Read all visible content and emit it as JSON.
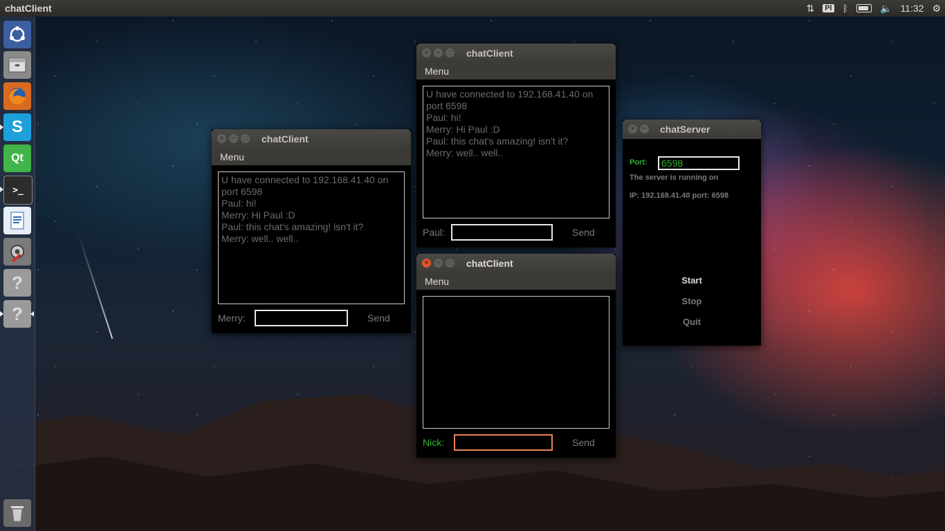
{
  "topbar": {
    "app_title": "chatClient",
    "keyboard_layout": "Pl",
    "time": "11:32"
  },
  "launcher": {
    "items": [
      {
        "name": "Dash home",
        "icon": "ubuntu-logo-icon"
      },
      {
        "name": "Files",
        "icon": "file-manager-icon"
      },
      {
        "name": "Firefox",
        "icon": "firefox-icon"
      },
      {
        "name": "Skype",
        "icon": "skype-icon",
        "glyph": "S"
      },
      {
        "name": "Qt Creator",
        "icon": "qt-creator-icon",
        "glyph": "Qt"
      },
      {
        "name": "Terminal",
        "icon": "terminal-icon",
        "glyph": ">_"
      },
      {
        "name": "LibreOffice Writer",
        "icon": "writer-icon"
      },
      {
        "name": "System Settings",
        "icon": "settings-icon"
      },
      {
        "name": "Unknown app",
        "icon": "unknown-app-icon",
        "glyph": "?"
      },
      {
        "name": "Unknown app",
        "icon": "unknown-app-icon",
        "glyph": "?"
      },
      {
        "name": "Trash",
        "icon": "trash-icon"
      }
    ]
  },
  "client_merry": {
    "title": "chatClient",
    "menu": "Menu",
    "messages": [
      "U have connected to 192.168.41.40 on port 6598",
      "Paul: hi!",
      "Merry: Hi Paul :D",
      "Paul: this chat's amazing! isn't it?",
      "Merry: well.. well.."
    ],
    "nick_label": "Merry:",
    "input_value": "",
    "send_label": "Send"
  },
  "client_paul": {
    "title": "chatClient",
    "menu": "Menu",
    "messages": [
      "U have connected to 192.168.41.40 on port 6598",
      "Paul: hi!",
      "Merry: Hi Paul :D",
      "Paul: this chat's amazing! isn't it?",
      "Merry: well.. well.."
    ],
    "nick_label": "Paul:",
    "input_value": "",
    "send_label": "Send"
  },
  "client_nick": {
    "title": "chatClient",
    "menu": "Menu",
    "messages": [],
    "nick_label": "Nick:",
    "input_value": "",
    "send_label": "Send"
  },
  "server": {
    "title": "chatServer",
    "port_label": "Port:",
    "port_value": "6598",
    "status_line1": "The server is running on",
    "status_line2": "IP: 192.168.41.40 port: 6598",
    "start_label": "Start",
    "stop_label": "Stop",
    "quit_label": "Quit"
  },
  "colors": {
    "green_label": "#2fb52f",
    "focus_border": "#e8845a",
    "close_active": "#e0532f"
  }
}
